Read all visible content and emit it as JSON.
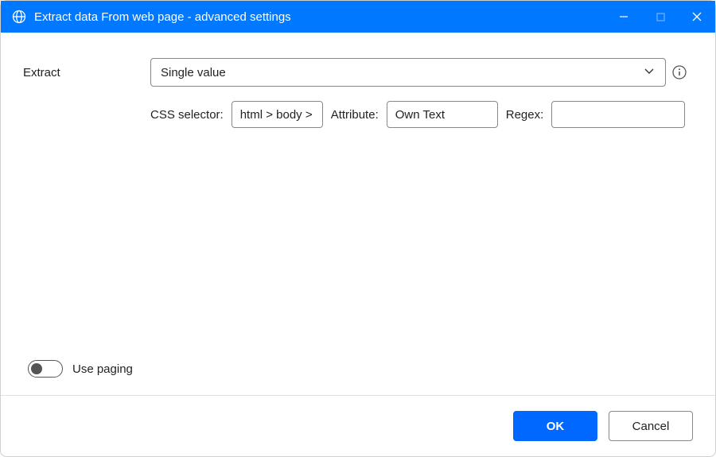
{
  "window": {
    "title": "Extract data From web page - advanced settings"
  },
  "form": {
    "extract_label": "Extract",
    "extract_value": "Single value",
    "css_selector_label": "CSS selector:",
    "css_selector_value": "html > body >",
    "attribute_label": "Attribute:",
    "attribute_value": "Own Text",
    "regex_label": "Regex:",
    "regex_value": "",
    "use_paging_label": "Use paging"
  },
  "footer": {
    "ok_label": "OK",
    "cancel_label": "Cancel"
  }
}
